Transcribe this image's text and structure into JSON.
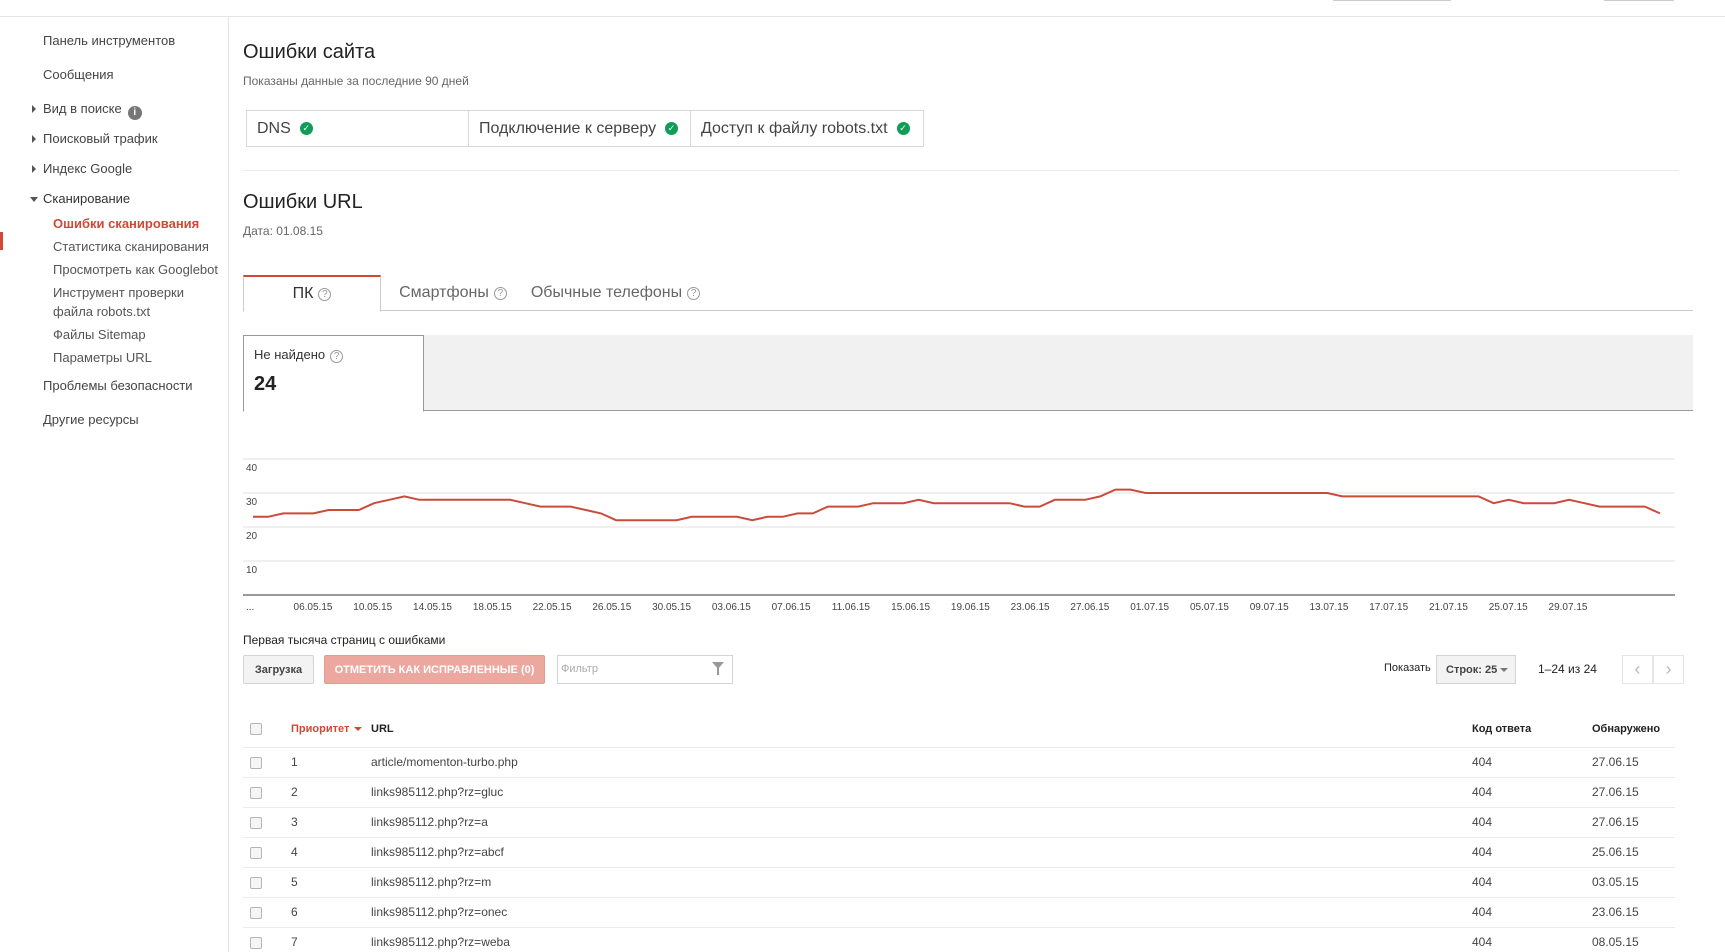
{
  "sidebar": {
    "dashboard": "Панель инструментов",
    "messages": "Сообщения",
    "search_appearance": "Вид в поиске",
    "search_traffic": "Поисковый трафик",
    "google_index": "Индекс Google",
    "crawl": "Сканирование",
    "crawl_items": [
      "Ошибки сканирования",
      "Статистика сканирования",
      "Просмотреть как Googlebot",
      "Инструмент проверки файла robots.txt",
      "Файлы Sitemap",
      "Параметры URL"
    ],
    "security": "Проблемы безопасности",
    "other": "Другие ресурсы"
  },
  "site_errors": {
    "title": "Ошибки сайта",
    "subtitle": "Показаны данные за последние 90 дней",
    "items": [
      {
        "label": "DNS",
        "status": "ok"
      },
      {
        "label": "Подключение к серверу",
        "status": "ok"
      },
      {
        "label": "Доступ к файлу robots.txt",
        "status": "ok"
      }
    ]
  },
  "url_errors": {
    "title": "Ошибки URL",
    "date": "Дата: 01.08.15",
    "tabs": [
      "ПК",
      "Смартфоны",
      "Обычные телефоны"
    ],
    "metric": {
      "label": "Не найдено",
      "value": "24"
    }
  },
  "chart_data": {
    "type": "line",
    "ylim": [
      0,
      40
    ],
    "yticks": [
      "10",
      "20",
      "30",
      "40"
    ],
    "xticks": [
      "...",
      "06.05.15",
      "10.05.15",
      "14.05.15",
      "18.05.15",
      "22.05.15",
      "26.05.15",
      "30.05.15",
      "03.06.15",
      "07.06.15",
      "11.06.15",
      "15.06.15",
      "19.06.15",
      "23.06.15",
      "27.06.15",
      "01.07.15",
      "05.07.15",
      "09.07.15",
      "13.07.15",
      "17.07.15",
      "21.07.15",
      "25.07.15",
      "29.07.15"
    ],
    "series": [
      {
        "color": "#cb4b3b",
        "values": [
          23,
          23,
          24,
          24,
          24,
          25,
          25,
          25,
          27,
          28,
          29,
          28,
          28,
          28,
          28,
          28,
          28,
          28,
          27,
          26,
          26,
          26,
          25,
          24,
          22,
          22,
          22,
          22,
          22,
          23,
          23,
          23,
          23,
          22,
          23,
          23,
          24,
          24,
          26,
          26,
          26,
          27,
          27,
          27,
          28,
          27,
          27,
          27,
          27,
          27,
          27,
          26,
          26,
          28,
          28,
          28,
          29,
          31,
          31,
          30,
          30,
          30,
          30,
          30,
          30,
          30,
          30,
          30,
          30,
          30,
          30,
          30,
          29,
          29,
          29,
          29,
          29,
          29,
          29,
          29,
          29,
          29,
          27,
          28,
          27,
          27,
          27,
          28,
          27,
          26,
          26,
          26,
          26,
          24
        ]
      }
    ]
  },
  "table_section": {
    "title": "Первая тысяча страниц с ошибками",
    "download": "Загрузка",
    "mark_fixed": "ОТМЕТИТЬ КАК ИСПРАВЛЕННЫЕ (0)",
    "filter_placeholder": "Фильтр",
    "show_label": "Показать",
    "rows_select": "Строк: 25",
    "pager": "1–24 из 24",
    "columns": {
      "priority": "Приоритет",
      "url": "URL",
      "code": "Код ответа",
      "detected": "Обнаружено"
    },
    "rows": [
      {
        "priority": "1",
        "url": "article/momenton-turbo.php",
        "code": "404",
        "detected": "27.06.15"
      },
      {
        "priority": "2",
        "url": "links985112.php?rz=gluc",
        "code": "404",
        "detected": "27.06.15"
      },
      {
        "priority": "3",
        "url": "links985112.php?rz=a",
        "code": "404",
        "detected": "27.06.15"
      },
      {
        "priority": "4",
        "url": "links985112.php?rz=abcf",
        "code": "404",
        "detected": "25.06.15"
      },
      {
        "priority": "5",
        "url": "links985112.php?rz=m",
        "code": "404",
        "detected": "03.05.15"
      },
      {
        "priority": "6",
        "url": "links985112.php?rz=onec",
        "code": "404",
        "detected": "23.06.15"
      },
      {
        "priority": "7",
        "url": "links985112.php?rz=weba",
        "code": "404",
        "detected": "08.05.15"
      }
    ]
  }
}
